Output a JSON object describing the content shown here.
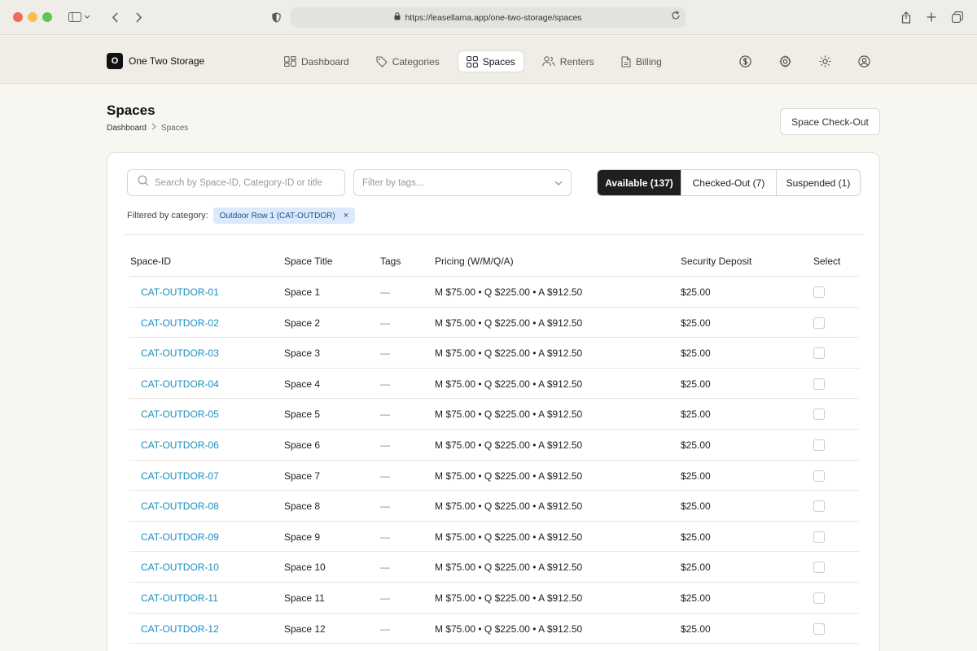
{
  "browser": {
    "url": "https://leasellama.app/one-two-storage/spaces"
  },
  "header": {
    "brand_initial": "O",
    "brand_name": "One Two Storage",
    "nav": [
      {
        "label": "Dashboard",
        "icon": "dashboard-icon",
        "active": false
      },
      {
        "label": "Categories",
        "icon": "tag-icon",
        "active": false
      },
      {
        "label": "Spaces",
        "icon": "grid-icon",
        "active": true
      },
      {
        "label": "Renters",
        "icon": "users-icon",
        "active": false
      },
      {
        "label": "Billing",
        "icon": "document-icon",
        "active": false
      }
    ],
    "right_icons": [
      "dollar-icon",
      "gear-icon",
      "sun-icon",
      "user-circle-icon"
    ]
  },
  "page": {
    "title": "Spaces",
    "breadcrumb": [
      "Dashboard",
      "Spaces"
    ],
    "checkout_button": "Space Check-Out"
  },
  "filters": {
    "search_placeholder": "Search by Space-ID, Category-ID or title",
    "tags_placeholder": "Filter by tags...",
    "segments": [
      {
        "label": "Available (137)",
        "active": true
      },
      {
        "label": "Checked-Out (7)",
        "active": false
      },
      {
        "label": "Suspended (1)",
        "active": false
      }
    ],
    "filtered_label": "Filtered by category:",
    "category_chip": "Outdoor Row 1 (CAT-OUTDOR)",
    "chip_remove": "×"
  },
  "table": {
    "columns": [
      "Space-ID",
      "Space Title",
      "Tags",
      "Pricing (W/M/Q/A)",
      "Security Deposit",
      "Select"
    ],
    "rows": [
      {
        "id": "CAT-OUTDOR-01",
        "title": "Space 1",
        "tags": "—",
        "pricing": "M $75.00 • Q $225.00 • A $912.50",
        "deposit": "$25.00"
      },
      {
        "id": "CAT-OUTDOR-02",
        "title": "Space 2",
        "tags": "—",
        "pricing": "M $75.00 • Q $225.00 • A $912.50",
        "deposit": "$25.00"
      },
      {
        "id": "CAT-OUTDOR-03",
        "title": "Space 3",
        "tags": "—",
        "pricing": "M $75.00 • Q $225.00 • A $912.50",
        "deposit": "$25.00"
      },
      {
        "id": "CAT-OUTDOR-04",
        "title": "Space 4",
        "tags": "—",
        "pricing": "M $75.00 • Q $225.00 • A $912.50",
        "deposit": "$25.00"
      },
      {
        "id": "CAT-OUTDOR-05",
        "title": "Space 5",
        "tags": "—",
        "pricing": "M $75.00 • Q $225.00 • A $912.50",
        "deposit": "$25.00"
      },
      {
        "id": "CAT-OUTDOR-06",
        "title": "Space 6",
        "tags": "—",
        "pricing": "M $75.00 • Q $225.00 • A $912.50",
        "deposit": "$25.00"
      },
      {
        "id": "CAT-OUTDOR-07",
        "title": "Space 7",
        "tags": "—",
        "pricing": "M $75.00 • Q $225.00 • A $912.50",
        "deposit": "$25.00"
      },
      {
        "id": "CAT-OUTDOR-08",
        "title": "Space 8",
        "tags": "—",
        "pricing": "M $75.00 • Q $225.00 • A $912.50",
        "deposit": "$25.00"
      },
      {
        "id": "CAT-OUTDOR-09",
        "title": "Space 9",
        "tags": "—",
        "pricing": "M $75.00 • Q $225.00 • A $912.50",
        "deposit": "$25.00"
      },
      {
        "id": "CAT-OUTDOR-10",
        "title": "Space 10",
        "tags": "—",
        "pricing": "M $75.00 • Q $225.00 • A $912.50",
        "deposit": "$25.00"
      },
      {
        "id": "CAT-OUTDOR-11",
        "title": "Space 11",
        "tags": "—",
        "pricing": "M $75.00 • Q $225.00 • A $912.50",
        "deposit": "$25.00"
      },
      {
        "id": "CAT-OUTDOR-12",
        "title": "Space 12",
        "tags": "—",
        "pricing": "M $75.00 • Q $225.00 • A $912.50",
        "deposit": "$25.00"
      }
    ]
  }
}
